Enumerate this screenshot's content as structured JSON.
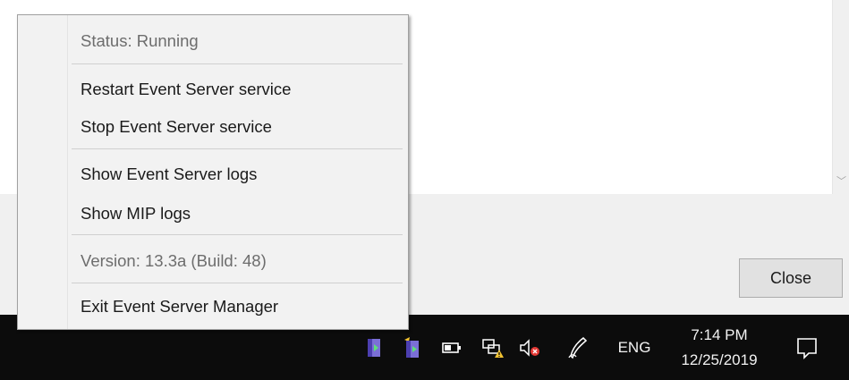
{
  "context_menu": {
    "status": "Status: Running",
    "restart": "Restart Event Server service",
    "stop": "Stop Event Server service",
    "show_event_logs": "Show Event Server logs",
    "show_mip_logs": "Show MIP logs",
    "version": "Version: 13.3a (Build: 48)",
    "exit": "Exit Event Server Manager"
  },
  "dialog": {
    "close_label": "Close"
  },
  "taskbar": {
    "language": "ENG",
    "time": "7:14 PM",
    "date": "12/25/2019",
    "tray_icons": [
      "event-server-manager-icon",
      "event-server-running-icon",
      "battery-icon",
      "network-warning-icon",
      "volume-muted-icon",
      "pen-icon"
    ],
    "notification_icon": "action-center-icon"
  },
  "colors": {
    "taskbar_bg": "#0c0c0c",
    "menu_bg": "#f2f2f2",
    "disabled_text": "#6d6d6d",
    "dialog_bg": "#f0f0f0"
  }
}
